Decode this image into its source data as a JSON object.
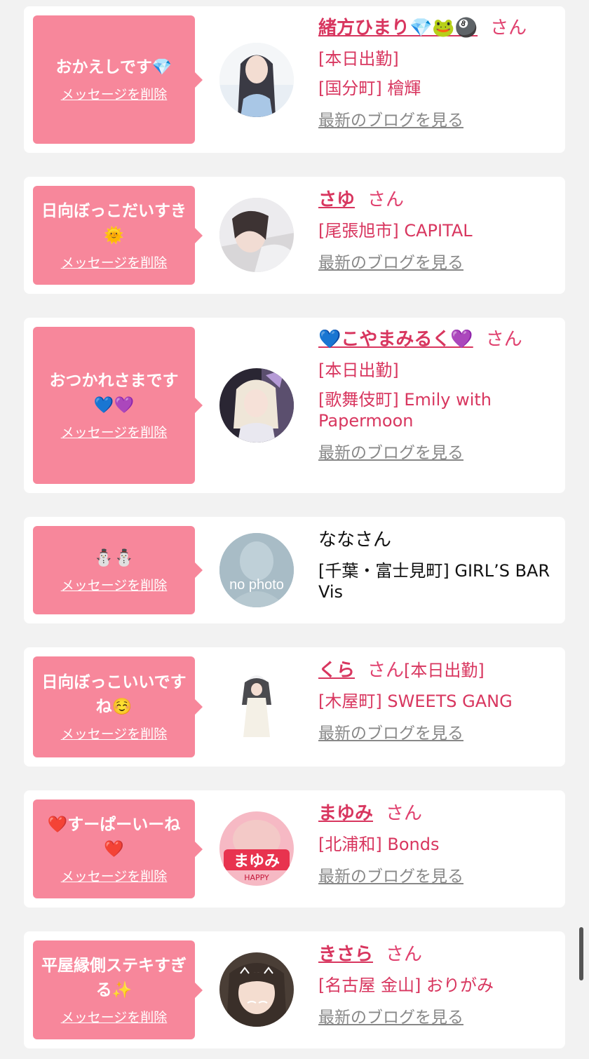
{
  "messages": [
    {
      "bubble_text": "おかえしです💎",
      "delete_label": "メッセージを削除",
      "name": "緒方ひまり💎🐸🎱",
      "san": "さん",
      "attendance": "[本日出勤]",
      "shop": "[国分町] 檜輝",
      "blog": "最新のブログを見る"
    },
    {
      "bubble_text": "日向ぼっこだいすき🌞",
      "delete_label": "メッセージを削除",
      "name": "さゆ",
      "san": "さん",
      "shop": "[尾張旭市] CAPITAL",
      "blog": "最新のブログを見る"
    },
    {
      "bubble_text": "おつかれさまです💙💜",
      "delete_label": "メッセージを削除",
      "name": "💙こやまみるく💜",
      "san": "さん",
      "attendance": "[本日出勤]",
      "shop": "[歌舞伎町] Emily with Papermoon",
      "blog": "最新のブログを見る"
    },
    {
      "bubble_text": "⛄⛄",
      "delete_label": "メッセージを削除",
      "name_plain": "ななさん",
      "shop": "[千葉・富士見町] GIRL’S BAR Vis",
      "avatar_text": "no photo"
    },
    {
      "bubble_text": "日向ぼっこいいですね☺️",
      "delete_label": "メッセージを削除",
      "name": "くら",
      "san": "さん",
      "attendance": "[本日出勤]",
      "shop": "[木屋町] SWEETS GANG",
      "blog": "最新のブログを見る"
    },
    {
      "bubble_text": "❤️すーぱーいーね❤️",
      "delete_label": "メッセージを削除",
      "name": "まゆみ",
      "san": "さん",
      "shop": "[北浦和] Bonds",
      "blog": "最新のブログを見る",
      "avatar_text": "まゆみ",
      "avatar_sub": "HAPPY"
    },
    {
      "bubble_text": "平屋縁側ステキすぎる✨",
      "delete_label": "メッセージを削除",
      "name": "きさら",
      "san": "さん",
      "shop": "[名古屋 金山] おりがみ",
      "blog": "最新のブログを見る"
    }
  ],
  "colors": {
    "bubble": "#f7879b",
    "accent": "#d8365f",
    "link_gray": "#888888",
    "background": "#f2f2f2"
  }
}
